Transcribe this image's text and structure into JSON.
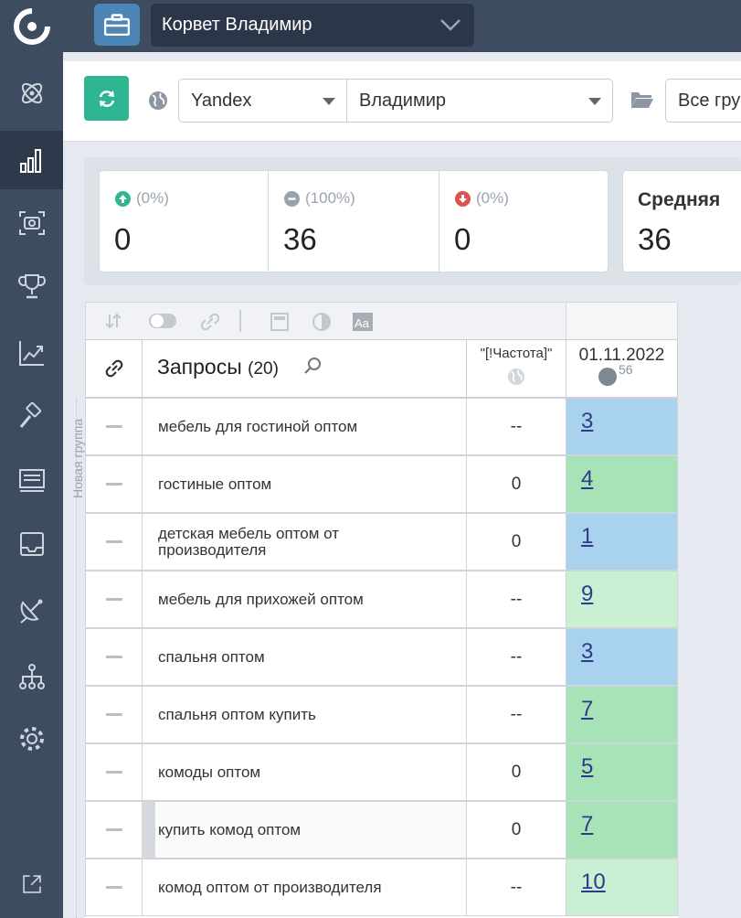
{
  "header": {
    "project_name": "Корвет Владимир"
  },
  "sidebar": {
    "items": [
      {
        "icon": "atom-icon"
      },
      {
        "icon": "bar-chart-icon",
        "active": true
      },
      {
        "icon": "camera-scan-icon"
      },
      {
        "icon": "trophy-icon"
      },
      {
        "icon": "trend-chart-icon"
      },
      {
        "icon": "hammer-icon"
      },
      {
        "icon": "billboard-icon"
      },
      {
        "icon": "inbox-icon"
      },
      {
        "icon": "satellite-icon"
      },
      {
        "icon": "sitemap-icon"
      },
      {
        "icon": "gear-icon"
      },
      {
        "icon": "external-link-icon"
      }
    ]
  },
  "toolbar": {
    "engine": "Yandex",
    "region": "Владимир",
    "groups": "Все гру"
  },
  "stats": {
    "up": {
      "pct": "(0%)",
      "value": "0",
      "color": "#2eb592"
    },
    "same": {
      "pct": "(100%)",
      "value": "36",
      "color": "#9aa3ad"
    },
    "down": {
      "pct": "(0%)",
      "value": "0",
      "color": "#d9534f"
    },
    "avg": {
      "label": "Средняя",
      "value": "36"
    }
  },
  "table": {
    "query_header": "Запросы",
    "query_count": "(20)",
    "freq_header": "\"[!Частота]\"",
    "date_header": "01.11.2022",
    "date_badge_count": "56",
    "group_label": "Новая группа",
    "rows": [
      {
        "query": "мебель для гостиной оптом",
        "freq": "--",
        "pos": "3",
        "color": "blue"
      },
      {
        "query": "гостиные оптом",
        "freq": "0",
        "pos": "4",
        "color": "green"
      },
      {
        "query": "детская мебель оптом от производителя",
        "freq": "0",
        "pos": "1",
        "color": "blue"
      },
      {
        "query": "мебель для прихожей оптом",
        "freq": "--",
        "pos": "9",
        "color": "ltgreen"
      },
      {
        "query": "спальня оптом",
        "freq": "--",
        "pos": "3",
        "color": "blue"
      },
      {
        "query": "спальня оптом купить",
        "freq": "--",
        "pos": "7",
        "color": "green"
      },
      {
        "query": "комоды оптом",
        "freq": "0",
        "pos": "5",
        "color": "green"
      },
      {
        "query": "купить комод оптом",
        "freq": "0",
        "pos": "7",
        "color": "green",
        "selected": true
      },
      {
        "query": "комод оптом от производителя",
        "freq": "--",
        "pos": "10",
        "color": "ltgreen"
      }
    ]
  }
}
